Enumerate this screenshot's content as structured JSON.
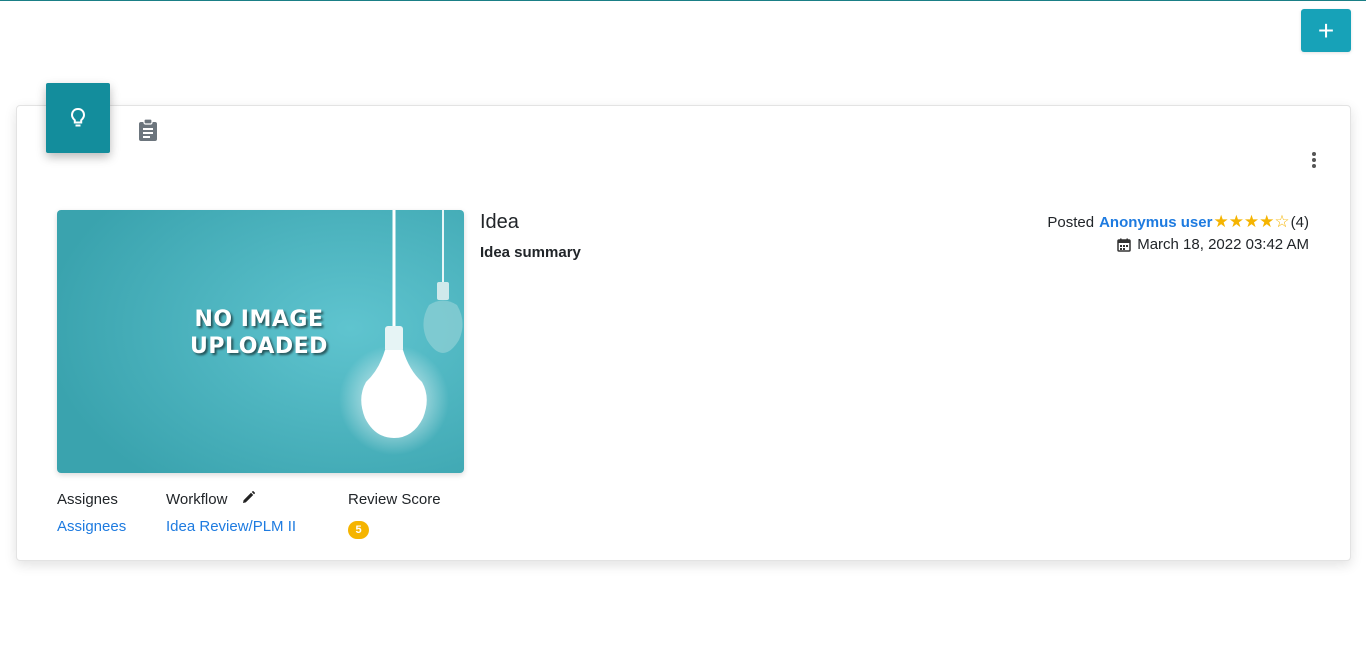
{
  "header": {
    "add_button_label": "+"
  },
  "tabs": [
    {
      "name": "idea",
      "icon": "lightbulb-icon"
    },
    {
      "name": "clipboard",
      "icon": "clipboard-icon"
    }
  ],
  "colors": {
    "accent": "#17a2b8",
    "tab_active": "#138d9c",
    "link": "#1e7be0",
    "star": "#f5b400"
  },
  "idea": {
    "image_text": "NO IMAGE UPLOADED",
    "title": "Idea",
    "summary": "Idea summary",
    "posted_label": "Posted",
    "author": "Anonymus user",
    "rating": 4,
    "rating_max": 5,
    "stars_display": "★★★★☆",
    "rating_count": "(4)",
    "date": "March 18, 2022 03:42 AM"
  },
  "details": {
    "assignees_label": "Assignes",
    "assignees_link": "Assignees",
    "workflow_label": "Workflow",
    "workflow_link": "Idea Review/PLM II",
    "review_score_label": "Review Score",
    "review_score": "5"
  }
}
